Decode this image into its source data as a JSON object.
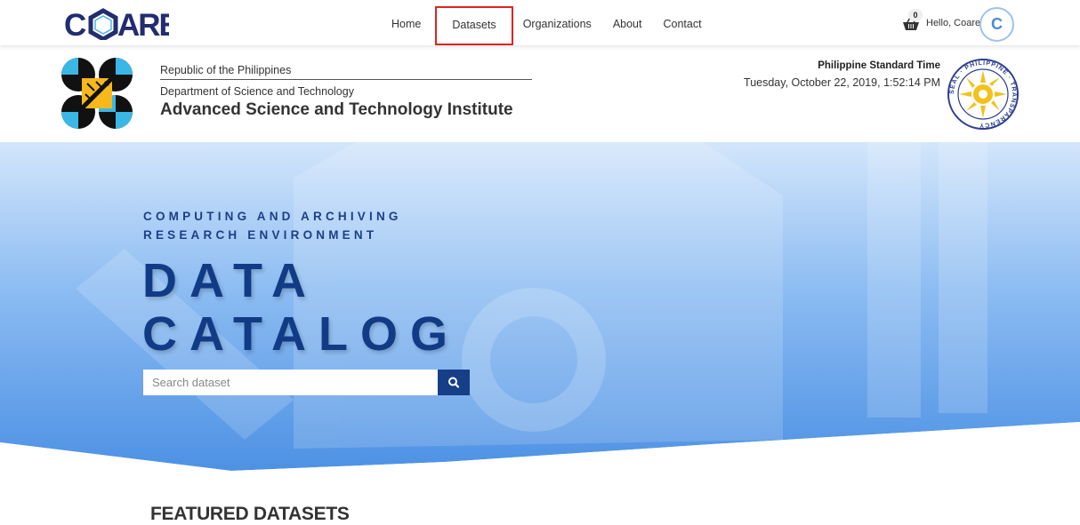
{
  "navbar": {
    "brand": "COARE",
    "links": [
      {
        "label": "Home"
      },
      {
        "label": "Datasets"
      },
      {
        "label": "Organizations"
      },
      {
        "label": "About"
      },
      {
        "label": "Contact"
      }
    ],
    "cart_count": "0",
    "greeting": "Hello, Coare!",
    "avatar_letter": "C"
  },
  "gov_header": {
    "republic": "Republic of the Philippines",
    "department": "Department of Science and Technology",
    "institute": "Advanced Science and Technology Institute",
    "time_label": "Philippine Standard Time",
    "time_value": "Tuesday, October 22, 2019, 1:52:14 PM",
    "seal_text": "SEAL · PHILIPPINE · TRANSPARENCY"
  },
  "hero": {
    "subtitle_line1": "COMPUTING AND ARCHIVING",
    "subtitle_line2": "RESEARCH ENVIRONMENT",
    "title_line1": "DATA",
    "title_line2": "CATALOG",
    "search_placeholder": "Search dataset",
    "search_icon": "search-icon"
  },
  "featured": {
    "heading": "FEATURED DATASETS"
  },
  "colors": {
    "brand_navy": "#222c6e",
    "hero_blue": "#5b9bea",
    "title_blue": "#123b86",
    "highlight_red": "#e02323"
  }
}
